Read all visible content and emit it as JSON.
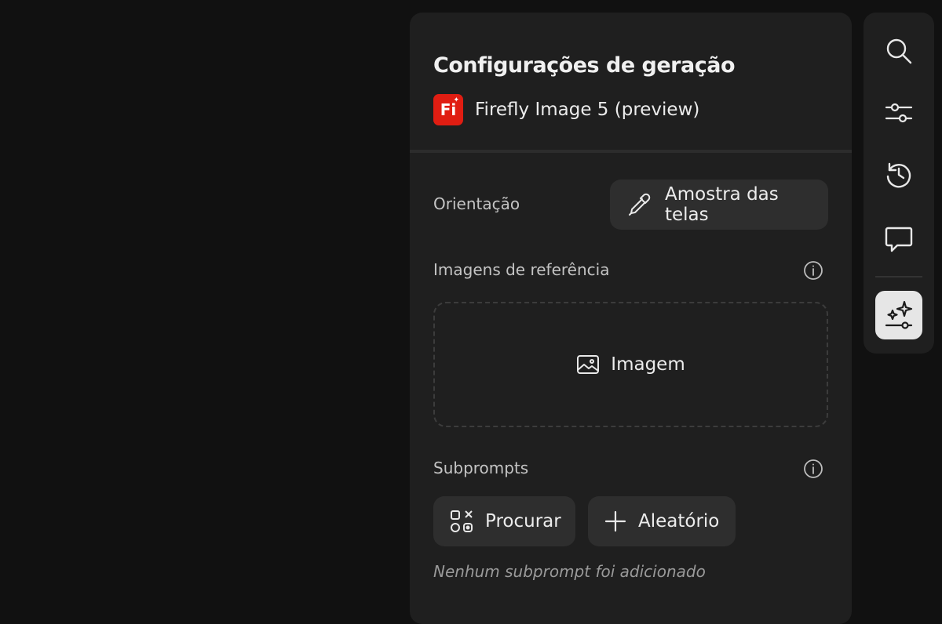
{
  "panel": {
    "title": "Configurações de geração",
    "model": {
      "logo_text": "Fi",
      "name": "Firefly Image 5 (preview)"
    },
    "orientation": {
      "label": "Orientação",
      "button_label": "Amostra das telas",
      "button_icon": "eyedropper-icon"
    },
    "reference_images": {
      "label": "Imagens de referência",
      "info_icon": "info-icon",
      "dropzone_label": "Imagem",
      "dropzone_icon": "image-icon"
    },
    "subprompts": {
      "label": "Subprompts",
      "info_icon": "info-icon",
      "browse_label": "Procurar",
      "browse_icon": "shapes-grid-icon",
      "random_label": "Aleatório",
      "random_icon": "plus-icon",
      "empty_message": "Nenhum subprompt foi adicionado"
    }
  },
  "rail": {
    "items": [
      {
        "name": "search",
        "icon": "search-icon"
      },
      {
        "name": "adjustments",
        "icon": "sliders-icon"
      },
      {
        "name": "history",
        "icon": "history-icon"
      },
      {
        "name": "comments",
        "icon": "chat-icon"
      },
      {
        "name": "generation-settings",
        "icon": "sparkle-sliders-icon",
        "active": true
      }
    ]
  },
  "colors": {
    "background": "#111111",
    "panel": "#1f1f1f",
    "button": "#2e2e2e",
    "brand": "#e01d12",
    "active_rail": "#e6e6e6"
  }
}
